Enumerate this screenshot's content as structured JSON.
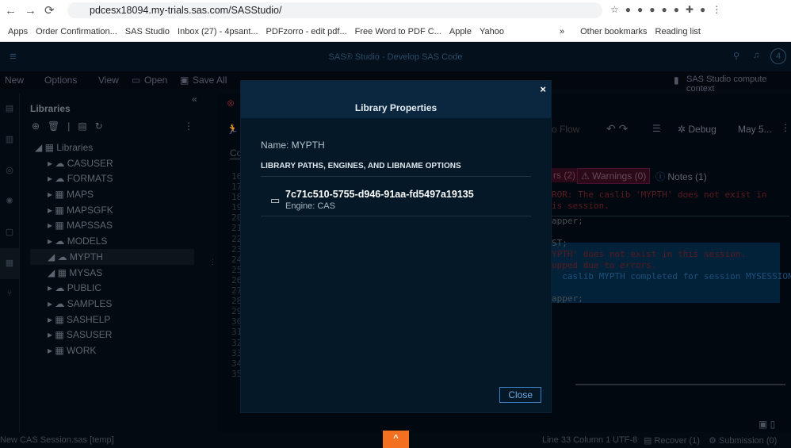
{
  "browser": {
    "url": "pdcesx18094.my-trials.sas.com/SASStudio/",
    "bookmarks": [
      "Apps",
      "Order Confirmation...",
      "SAS Studio",
      "Inbox (27) - 4psant...",
      "PDFzorro - edit pdf...",
      "Free Word to PDF C...",
      "Apple",
      "Yahoo"
    ],
    "other_bookmarks": "Other bookmarks",
    "reading_list": "Reading list",
    "more": "»"
  },
  "app": {
    "title": "SAS® Studio - Develop SAS Code",
    "notif_count": "4",
    "context": "SAS Studio compute context"
  },
  "menu": {
    "new": "New",
    "options": "Options",
    "view": "View",
    "open": "Open",
    "save_all": "Save All"
  },
  "sidebar": {
    "title": "Libraries",
    "root": "Libraries",
    "items": [
      "CASUSER",
      "FORMATS",
      "MAPS",
      "MAPSGFK",
      "MAPSSAS",
      "MODELS",
      "MYPTH",
      "MYSAS",
      "PUBLIC",
      "SAMPLES",
      "SASHELP",
      "SASUSER",
      "WORK"
    ]
  },
  "editor": {
    "flow": "o Flow",
    "debug": "Debug",
    "date": "May 5...",
    "tab_code": "Co",
    "line_numbers": [
      "16",
      "17",
      "18",
      "19",
      "20",
      "21",
      "22",
      "23",
      "24",
      "25",
      "26",
      "27",
      "28",
      "29",
      "30",
      "31",
      "32",
      "33",
      "34",
      "35"
    ],
    "errors": "rs (2)",
    "warnings": "Warnings (0)",
    "notes": "Notes (1)",
    "err_msg1": "ROR: The caslib 'MYPTH' does not exist in",
    "err_msg2": "is session.",
    "log": [
      "apper;",
      "",
      "ST;",
      "YPTH' does not exist in this session.",
      "opped due to errors.",
      "  caslib MYPTH completed for session MYSESSION.",
      "",
      "apper;"
    ]
  },
  "modal": {
    "title": "Library Properties",
    "name_label": "Name: MYPTH",
    "section": "LIBRARY PATHS, ENGINES, AND LIBNAME OPTIONS",
    "path": "7c71c510-5755-d946-91aa-fd5497a19135",
    "engine": "Engine: CAS",
    "close": "Close"
  },
  "status": {
    "file": "New CAS Session.sas [temp]",
    "position": "Line 33 Column 1",
    "encoding": "UTF-8",
    "recover": "Recover (1)",
    "submission": "Submission (0)"
  }
}
